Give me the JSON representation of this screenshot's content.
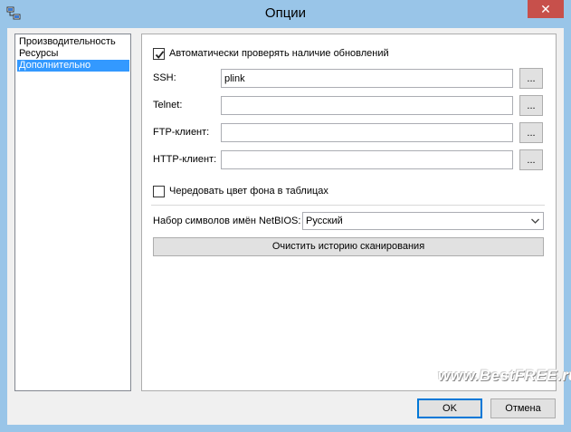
{
  "window": {
    "title": "Опции",
    "close_glyph": "✕"
  },
  "nav": {
    "items": [
      {
        "label": "Производительность"
      },
      {
        "label": "Ресурсы"
      },
      {
        "label": "Дополнительно"
      }
    ],
    "selected": "Дополнительно"
  },
  "options": {
    "auto_update": {
      "label": "Автоматически проверять наличие обновлений",
      "checked": true
    },
    "fields": [
      {
        "label": "SSH:",
        "value": "plink",
        "button": "..."
      },
      {
        "label": "Telnet:",
        "value": "",
        "button": "..."
      },
      {
        "label": "FTP-клиент:",
        "value": "",
        "button": "..."
      },
      {
        "label": "HTTP-клиент:",
        "value": "",
        "button": "..."
      }
    ],
    "alternate_rows": {
      "label": "Чередовать цвет фона в таблицах",
      "checked": false
    },
    "charset": {
      "label": "Набор символов имён NetBIOS:",
      "value": "Русский"
    },
    "clear_history_label": "Очистить историю сканирования"
  },
  "footer": {
    "ok_label": "OK",
    "cancel_label": "Отмена"
  },
  "watermark": "www.BestFREE.ru",
  "colors": {
    "frame": "#99c5e8",
    "close": "#c7504b",
    "selection": "#3399ff",
    "default_button_border": "#0078d7"
  },
  "icons": {
    "app": "network-computers-icon",
    "close": "close-icon",
    "check": "checkmark-icon",
    "dropdown": "chevron-down-icon"
  }
}
